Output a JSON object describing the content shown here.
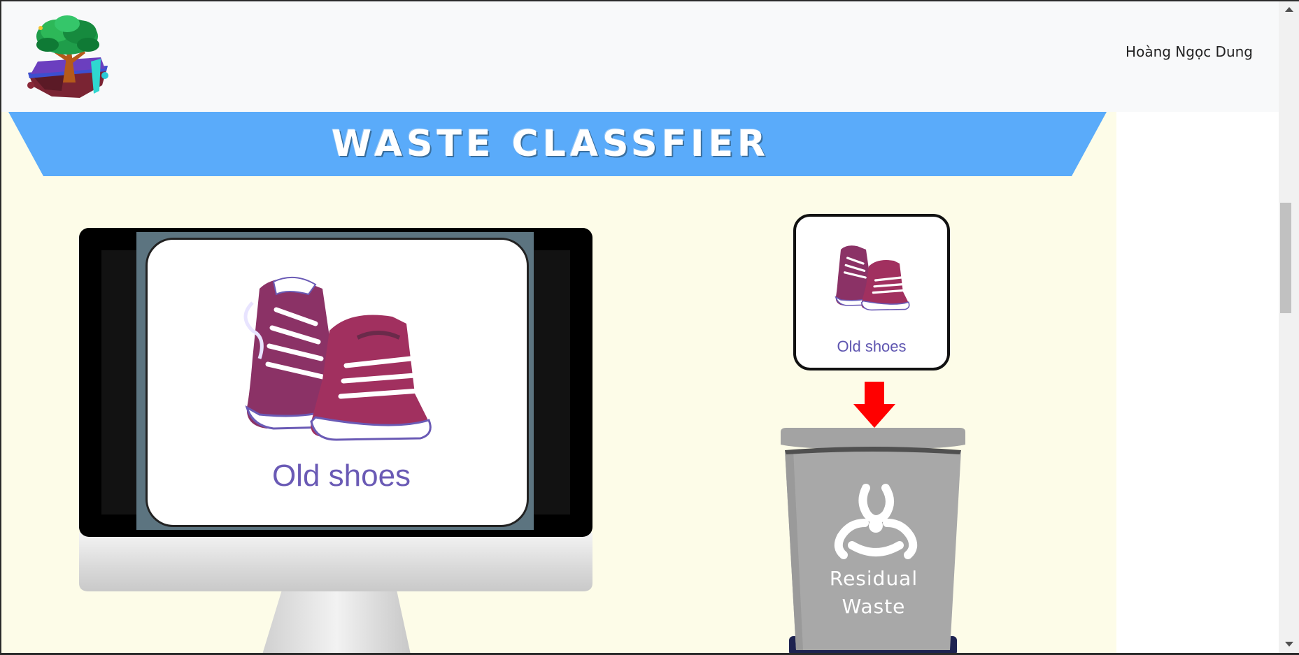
{
  "navbar": {
    "user_name": "Hoàng Ngọc Dung",
    "logo_icon": "tree-island-logo"
  },
  "banner": {
    "title": "WASTE CLASSFIER",
    "color": "#5aabfa"
  },
  "classified_item": {
    "label": "Old shoes",
    "thumbnail_label": "Old shoes",
    "image_icon": "sneakers-icon"
  },
  "result": {
    "arrow_icon": "arrow-down-icon",
    "arrow_color": "#ff0000",
    "bin_icon": "biohazard-icon",
    "bin_label_line1": "Residual",
    "bin_label_line2": "Waste",
    "bin_color": "#a8a8a8"
  },
  "colors": {
    "page_background": "#fdfce8",
    "navbar_background": "#f8f9fa"
  }
}
